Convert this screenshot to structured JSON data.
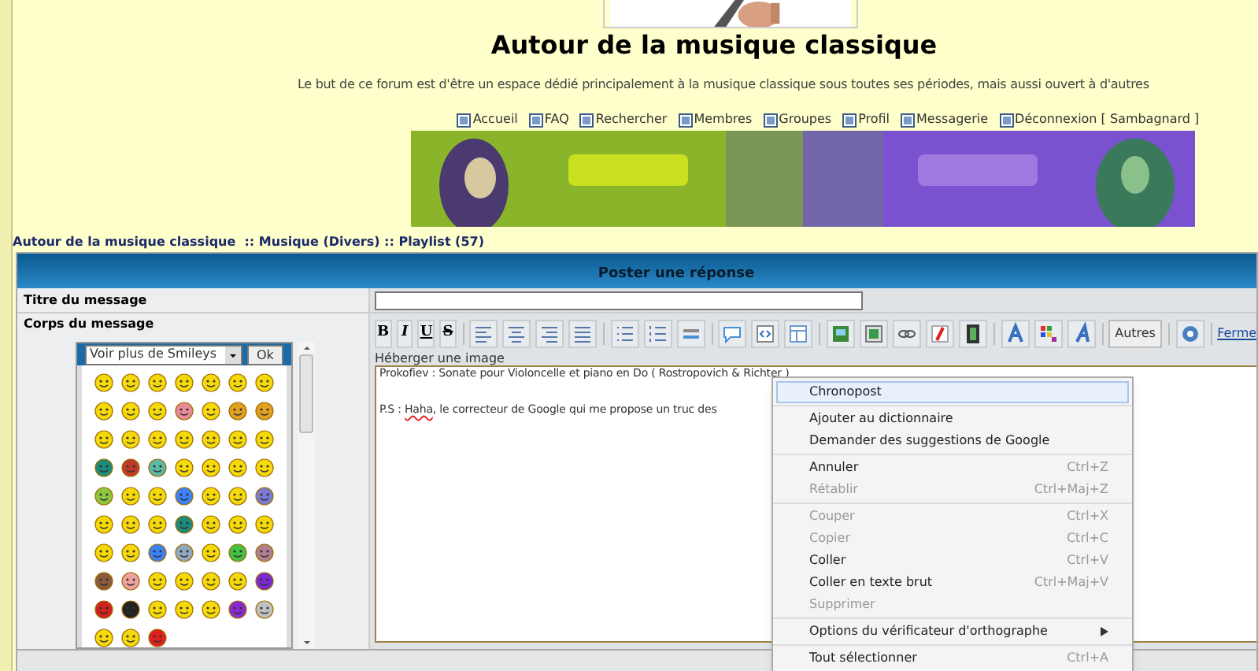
{
  "site": {
    "title": "Autour de la musique classique",
    "description": "Le but de ce forum est d'être un espace dédié principalement à la musique classique sous toutes ses périodes, mais aussi ouvert à d'autres"
  },
  "nav": [
    {
      "label": "Accueil"
    },
    {
      "label": "FAQ"
    },
    {
      "label": "Rechercher"
    },
    {
      "label": "Membres"
    },
    {
      "label": "Groupes"
    },
    {
      "label": "Profil"
    },
    {
      "label": "Messagerie"
    },
    {
      "label": "Déconnexion [ Sambagnard ]"
    }
  ],
  "breadcrumb": "Autour de la musique classique  :: Musique (Divers) :: Playlist (57)",
  "form": {
    "header": "Poster une réponse",
    "title_label": "Titre du message",
    "body_label": "Corps du message",
    "smileys": {
      "select": "Voir plus de Smileys",
      "ok": "Ok"
    },
    "toolbar": [
      {
        "kind": "text",
        "label": "B"
      },
      {
        "kind": "text",
        "label": "I"
      },
      {
        "kind": "text",
        "label": "U"
      },
      {
        "kind": "text",
        "label": "S"
      },
      {
        "kind": "sep"
      },
      {
        "kind": "icon"
      },
      {
        "kind": "icon"
      },
      {
        "kind": "icon"
      },
      {
        "kind": "icon"
      },
      {
        "kind": "sep"
      },
      {
        "kind": "icon"
      },
      {
        "kind": "icon"
      },
      {
        "kind": "icon"
      },
      {
        "kind": "sep"
      },
      {
        "kind": "icon"
      },
      {
        "kind": "icon"
      },
      {
        "kind": "icon"
      },
      {
        "kind": "sep"
      },
      {
        "kind": "icon"
      },
      {
        "kind": "icon"
      },
      {
        "kind": "icon"
      },
      {
        "kind": "icon"
      },
      {
        "kind": "icon"
      },
      {
        "kind": "sep"
      },
      {
        "kind": "icon"
      },
      {
        "kind": "icon"
      },
      {
        "kind": "icon"
      },
      {
        "kind": "sep"
      },
      {
        "kind": "button",
        "label": "Autres"
      },
      {
        "kind": "sep"
      },
      {
        "kind": "icon"
      },
      {
        "kind": "sep"
      },
      {
        "kind": "link",
        "label": "Ferme"
      }
    ],
    "upload_link": "Héberger une image",
    "body_lines": [
      [
        {
          "text": "Prokofiev : Sonate pour Violoncelle et piano en Do ( Rostropovich & Richter )",
          "misspelled": false
        }
      ],
      [
        {
          "text": "P.S : ",
          "misspelled": false
        },
        {
          "text": "Haha",
          "misspelled": true
        },
        {
          "text": ", le correcteur de Google qui me propose un truc des",
          "misspelled": false
        }
      ]
    ]
  },
  "context_menu": [
    [
      {
        "label": "Chronopost",
        "selected": true,
        "disabled": false
      }
    ],
    [
      {
        "label": "Ajouter au dictionnaire",
        "selected": false,
        "disabled": false
      },
      {
        "label": "Demander des suggestions de Google",
        "selected": false,
        "disabled": false
      }
    ],
    [
      {
        "label": "Annuler",
        "shortcut": "Ctrl+Z",
        "selected": false,
        "disabled": false
      },
      {
        "label": "Rétablir",
        "shortcut": "Ctrl+Maj+Z",
        "selected": false,
        "disabled": true
      }
    ],
    [
      {
        "label": "Couper",
        "shortcut": "Ctrl+X",
        "selected": false,
        "disabled": true
      },
      {
        "label": "Copier",
        "shortcut": "Ctrl+C",
        "selected": false,
        "disabled": true
      },
      {
        "label": "Coller",
        "shortcut": "Ctrl+V",
        "selected": false,
        "disabled": false
      },
      {
        "label": "Coller en texte brut",
        "shortcut": "Ctrl+Maj+V",
        "selected": false,
        "disabled": false
      },
      {
        "label": "Supprimer",
        "selected": false,
        "disabled": true
      }
    ],
    [
      {
        "label": "Options du vérificateur d'orthographe",
        "submenu": true,
        "selected": false,
        "disabled": false
      }
    ],
    [
      {
        "label": "Tout sélectionner",
        "shortcut": "Ctrl+A",
        "submenu": false,
        "selected": false,
        "disabled": false
      }
    ]
  ]
}
